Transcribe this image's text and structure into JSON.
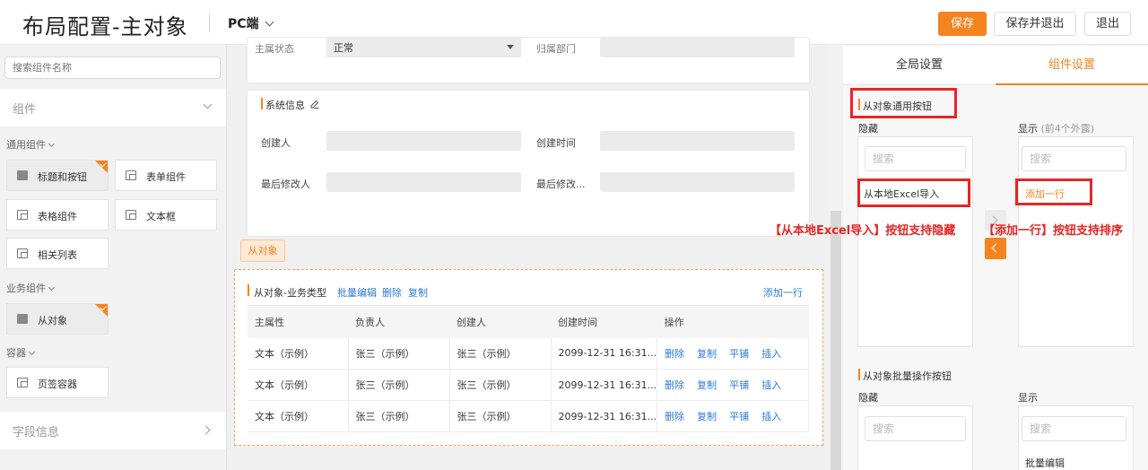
{
  "header": {
    "title": "布局配置-主对象",
    "platform": "PC端",
    "save": "保存",
    "save_exit": "保存并退出",
    "exit": "退出"
  },
  "sidebar": {
    "search_placeholder": "搜索组件名称",
    "components_section": "组件",
    "groups": [
      {
        "label": "通用组件",
        "items": [
          "标题和按钮",
          "表单组件",
          "表格组件",
          "文本框",
          "相关列表"
        ]
      },
      {
        "label": "业务组件",
        "items": [
          "从对象"
        ]
      },
      {
        "label": "容器",
        "items": [
          "页签容器"
        ]
      }
    ],
    "fields_section": "字段信息"
  },
  "canvas": {
    "top_partial": {
      "label1": "主属状态",
      "value1": "正常",
      "label2": "归属部门"
    },
    "system_info": {
      "title": "系统信息",
      "fields": [
        "创建人",
        "创建时间",
        "最后修改人",
        "最后修改..."
      ]
    },
    "tag": "从对象",
    "subobject": {
      "title": "从对象-业务类型",
      "actions": [
        "批量编辑",
        "删除",
        "复制"
      ],
      "add_row": "添加一行",
      "columns": [
        "主属性",
        "负责人",
        "创建人",
        "创建时间",
        "操作"
      ],
      "rows": [
        [
          "文本（示例）",
          "张三（示例）",
          "张三（示例）",
          "2099-12-31 16:31..."
        ],
        [
          "文本（示例）",
          "张三（示例）",
          "张三（示例）",
          "2099-12-31 16:31..."
        ],
        [
          "文本（示例）",
          "张三（示例）",
          "张三（示例）",
          "2099-12-31 16:31..."
        ]
      ],
      "row_actions": [
        "删除",
        "复制",
        "平铺",
        "插入"
      ]
    }
  },
  "right_panel": {
    "tabs": [
      "全局设置",
      "组件设置"
    ],
    "active_tab": "组件设置",
    "section1": {
      "title": "从对象通用按钮",
      "hidden_label": "隐藏",
      "shown_label": "显示",
      "shown_note": "(前4个外露)",
      "search": "搜索",
      "hidden_items": [
        "从本地Excel导入"
      ],
      "shown_items": [
        "添加一行"
      ]
    },
    "section2": {
      "title": "从对象批量操作按钮",
      "hidden_label": "隐藏",
      "shown_label": "显示",
      "search": "搜索",
      "shown_items": [
        "批量编辑"
      ]
    }
  },
  "annotations": {
    "left": "【从本地Excel导入】按钮支持隐藏",
    "right": "【添加一行】按钮支持排序"
  },
  "colors": {
    "accent": "#f5841f",
    "link": "#2f7bd8",
    "annotation": "#e52626"
  }
}
